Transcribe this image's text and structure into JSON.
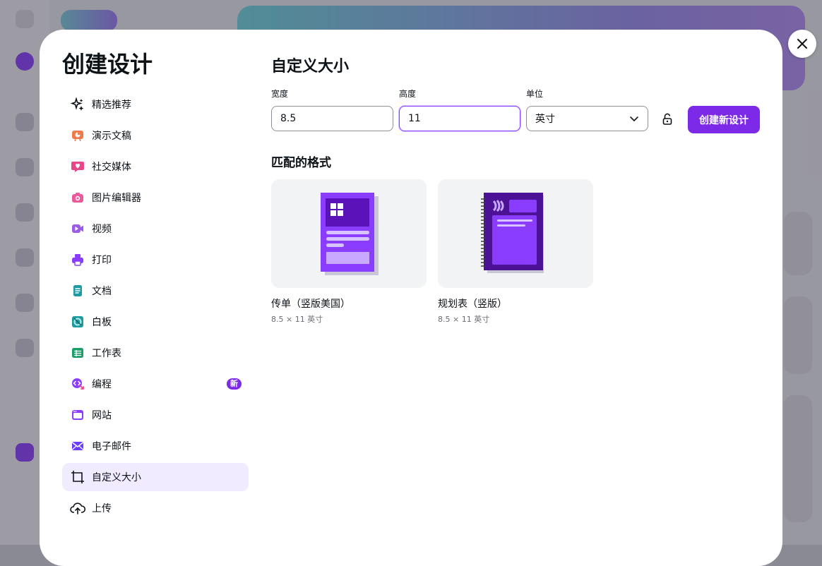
{
  "modal": {
    "title": "创建设计",
    "close_label": "close"
  },
  "sidebar": {
    "items": [
      {
        "label": "精选推荐",
        "icon": "sparkle-icon",
        "color": "#0e1318"
      },
      {
        "label": "演示文稿",
        "icon": "presentation-icon",
        "color": "#f07b4a"
      },
      {
        "label": "社交媒体",
        "icon": "heart-chat-icon",
        "color": "#e8488a"
      },
      {
        "label": "图片编辑器",
        "icon": "camera-icon",
        "color": "#e85a9a"
      },
      {
        "label": "视频",
        "icon": "video-icon",
        "color": "#9b5de5"
      },
      {
        "label": "打印",
        "icon": "printer-icon",
        "color": "#8b3dff"
      },
      {
        "label": "文档",
        "icon": "document-icon",
        "color": "#1c9ba0"
      },
      {
        "label": "白板",
        "icon": "whiteboard-icon",
        "color": "#1c9ba0"
      },
      {
        "label": "工作表",
        "icon": "spreadsheet-icon",
        "color": "#1a9e6a"
      },
      {
        "label": "编程",
        "icon": "code-icon",
        "color": "#8b3dff",
        "badge": "新"
      },
      {
        "label": "网站",
        "icon": "website-icon",
        "color": "#8b3dff"
      },
      {
        "label": "电子邮件",
        "icon": "email-icon",
        "color": "#6a3dff"
      },
      {
        "label": "自定义大小",
        "icon": "resize-icon",
        "color": "#0e1318",
        "active": true
      },
      {
        "label": "上传",
        "icon": "cloud-upload-icon",
        "color": "#0e1318"
      }
    ]
  },
  "custom_size": {
    "title": "自定义大小",
    "width_label": "宽度",
    "width_value": "8.5",
    "height_label": "高度",
    "height_value": "11",
    "unit_label": "单位",
    "unit_value": "英寸",
    "create_label": "创建新设计"
  },
  "matched": {
    "title": "匹配的格式",
    "formats": [
      {
        "name": "传单（竖版美国）",
        "size": "8.5 × 11 英寸"
      },
      {
        "name": "规划表（竖版）",
        "size": "8.5 × 11 英寸"
      }
    ]
  },
  "colors": {
    "accent": "#7d2ae8",
    "active_bg": "#f0ebff"
  }
}
